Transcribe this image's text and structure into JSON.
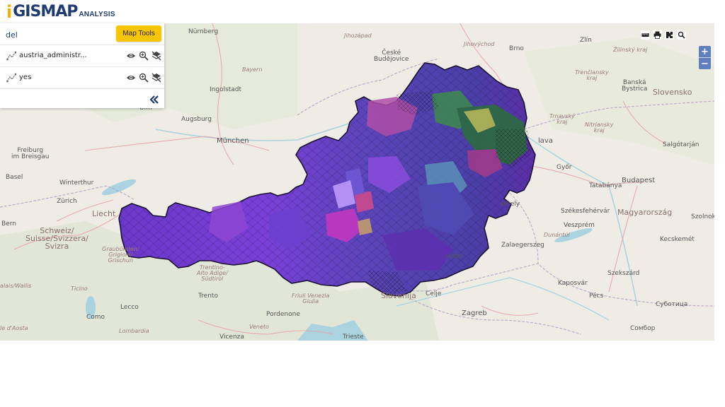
{
  "logo": {
    "letter_i": "i",
    "main": "GISMAP",
    "sub": "ANALYSIS"
  },
  "panel": {
    "search_value": "del",
    "map_tools_label": "Map Tools",
    "layers": [
      {
        "name": "austria_administr..."
      },
      {
        "name": "yes"
      }
    ],
    "collapse_glyph": "«"
  },
  "zoom": {
    "in_label": "+",
    "out_label": "−"
  },
  "map_labels": {
    "nurnberg": "Nürnberg",
    "zapad": "Jihozápad",
    "ceske": "České\nBudějovice",
    "jihovychod": "Jihovýchod",
    "brno": "Brno",
    "zlin": "Zlín",
    "zilinsky": "Žilinský kraj",
    "bayern": "Bayern",
    "ingolstadt": "Ingolstadt",
    "trenciansky": "Trenčiansky\nkraj",
    "banska": "Banská\nBystrica",
    "slovensko": "Slovensko",
    "ulm": "Ulm",
    "augsburg": "Augsburg",
    "trnavsky": "Trnavský\nkraj",
    "nitriansky": "Nitriansky\nkraj",
    "freiburg": "Freiburg\nim Breisgau",
    "munchen": "München",
    "lava": "lava",
    "salgotarjan": "Salgótarján",
    "basel": "Basel",
    "winterthur": "Winterthur",
    "gyor": "Győr",
    "tatabanya": "Tatabánya",
    "budapest": "Budapest",
    "zurich": "Zürich",
    "liecht": "Liecht",
    "bern": "Bern",
    "schweiz": "Schweiz/\nSuisse/Svizzera/\nSvizra",
    "athely": "athely",
    "szekesfehervar": "Székesfehérvár",
    "magyar": "Magyarország",
    "szolnok": "Szolnok",
    "veszprem": "Veszprém",
    "dunantul": "Dunántúl",
    "graub": "Graubünden/\nGrigioni/\nGrischun",
    "zalaeg": "Zalaegerszeg",
    "kecskemet": "Kecskemét",
    "trentino": "Trentino-\nAlto Adige/\nSüdtirol",
    "maribor": "aribor",
    "szekszard": "Szekszárd",
    "alais": "alais/Wallis",
    "ticino": "Ticino",
    "kaposvar": "Kaposvár",
    "slovenija": "Slovenija",
    "celje": "Celje",
    "trento": "Trento",
    "friuli": "Friuli Venezia\nGiulia",
    "pecs": "Pécs",
    "subotica": "Суботица",
    "como": "Como",
    "lecco": "Lecco",
    "zagreb": "Zagreb",
    "pordenone": "Pordenone",
    "aosta": "le d'Aosta",
    "lombardia": "Lombardia",
    "veneto": "Veneto",
    "sombor": "Сомбор",
    "vicenza": "Vicenza",
    "trieste": "Trieste"
  }
}
